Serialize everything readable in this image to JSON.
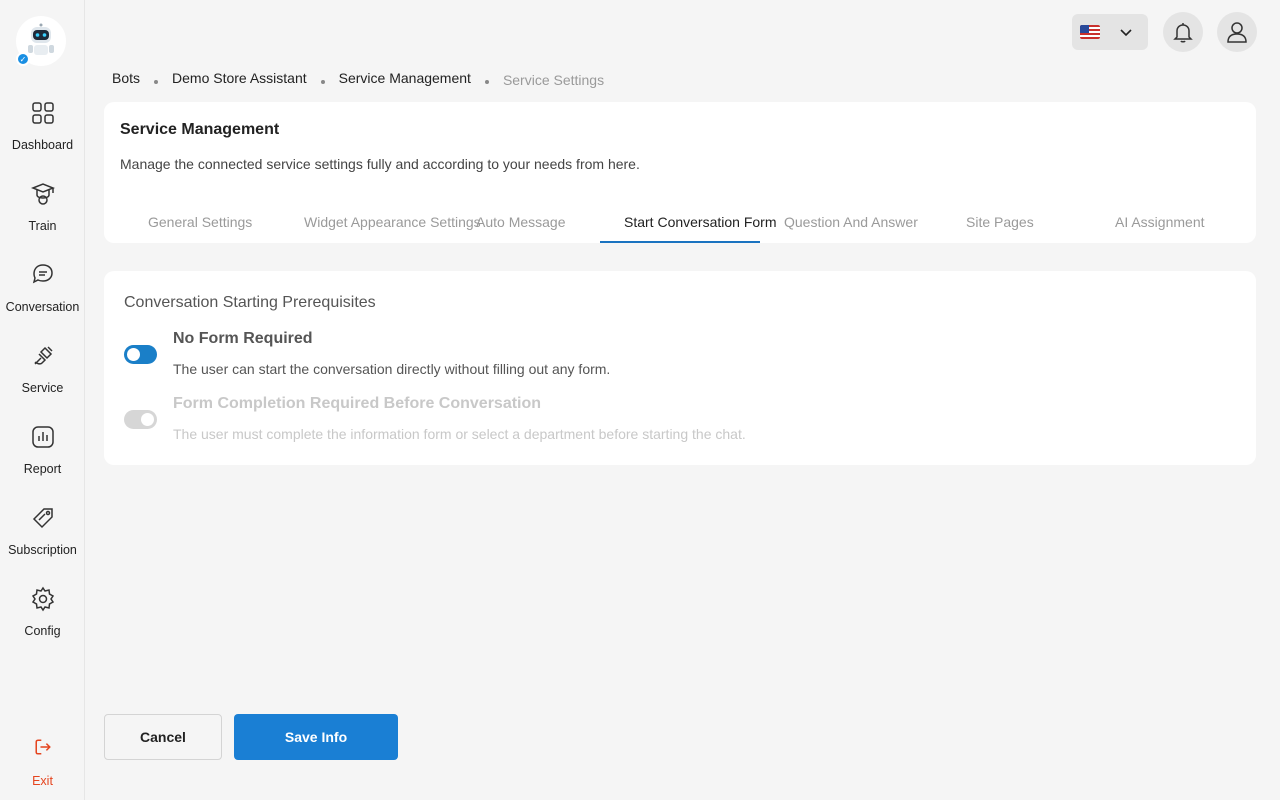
{
  "sidebar": {
    "items": [
      {
        "label": "Dashboard",
        "icon": "dashboard-icon"
      },
      {
        "label": "Train",
        "icon": "train-icon"
      },
      {
        "label": "Conversation",
        "icon": "conversation-icon"
      },
      {
        "label": "Service",
        "icon": "service-icon"
      },
      {
        "label": "Report",
        "icon": "report-icon"
      },
      {
        "label": "Subscription",
        "icon": "subscription-icon"
      },
      {
        "label": "Config",
        "icon": "config-icon"
      }
    ],
    "exit_label": "Exit"
  },
  "header": {
    "language_flag": "us-flag-icon"
  },
  "breadcrumb": [
    "Bots",
    "Demo Store Assistant",
    "Service Management",
    "Service Settings"
  ],
  "page": {
    "title": "Service Management",
    "description": "Manage the connected service settings fully and according to your needs from here.",
    "tabs": [
      {
        "label": "General Settings"
      },
      {
        "label": "Widget Appearance Settings"
      },
      {
        "label": "Auto Message"
      },
      {
        "label": "Start Conversation Form"
      },
      {
        "label": "Question And Answer"
      },
      {
        "label": "Site Pages"
      },
      {
        "label": "AI Assignment"
      }
    ],
    "active_tab": "Start Conversation Form"
  },
  "prerequisites": {
    "title": "Conversation Starting Prerequisites",
    "options": [
      {
        "title": "No Form Required",
        "description": "The user can start the conversation directly without filling out any form.",
        "enabled": true
      },
      {
        "title": "Form Completion Required Before Conversation",
        "description": "The user must complete the information form or select a department before starting the chat.",
        "enabled": false
      }
    ]
  },
  "footer": {
    "cancel_label": "Cancel",
    "save_label": "Save Info"
  },
  "colors": {
    "accent": "#1a7fd4",
    "exit": "#e5451f",
    "background": "#f5f5f5"
  }
}
